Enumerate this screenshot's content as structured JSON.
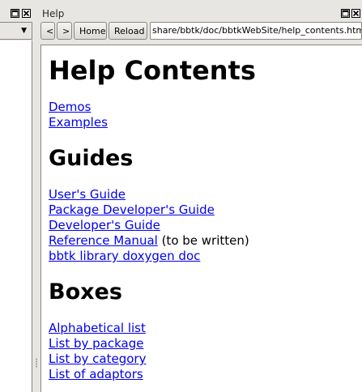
{
  "left_panel": {
    "restore_icon": "restore-window-icon",
    "close_icon": "close-icon",
    "dropdown_icon": "dropdown-arrow-icon"
  },
  "help_panel": {
    "title": "Help",
    "toolbar": {
      "back_label": "<",
      "forward_label": ">",
      "home_label": "Home",
      "reload_label": "Reload",
      "url": "share/bbtk/doc/bbtkWebSite/help_contents.html"
    }
  },
  "page": {
    "heading": "Help Contents",
    "top_links": [
      "Demos",
      "Examples"
    ],
    "guides": {
      "heading": "Guides",
      "links": {
        "users_guide": "User's Guide",
        "package_dev_guide": "Package Developer's Guide",
        "dev_guide": "Developer's Guide",
        "reference_manual": "Reference Manual",
        "reference_manual_note": " (to be written)",
        "doxygen": "bbtk library doxygen doc"
      }
    },
    "boxes": {
      "heading": "Boxes",
      "links": [
        "Alphabetical list",
        "List by package",
        "List by category",
        "List of adaptors"
      ]
    }
  }
}
